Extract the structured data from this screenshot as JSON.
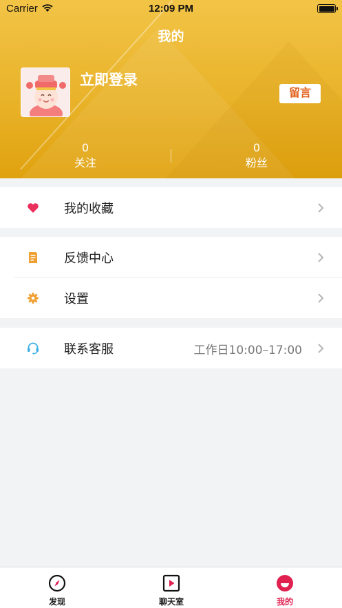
{
  "status_bar": {
    "carrier": "Carrier",
    "time": "12:09 PM"
  },
  "header": {
    "title": "我的",
    "login_text": "立即登录",
    "message_button": "留言",
    "stats": [
      {
        "value": "0",
        "label": "关注"
      },
      {
        "value": "0",
        "label": "粉丝"
      }
    ]
  },
  "menu": {
    "favorites": {
      "label": "我的收藏",
      "icon": "heart-icon"
    },
    "feedback": {
      "label": "反馈中心",
      "icon": "document-icon"
    },
    "settings": {
      "label": "设置",
      "icon": "gear-icon"
    },
    "support": {
      "label": "联系客服",
      "value": "工作日10:00–17:00",
      "icon": "headset-icon"
    }
  },
  "tabbar": {
    "tabs": [
      {
        "label": "发现",
        "icon": "compass-icon"
      },
      {
        "label": "聊天室",
        "icon": "play-icon"
      },
      {
        "label": "我的",
        "icon": "profile-icon",
        "active": true
      }
    ]
  },
  "colors": {
    "header_gradient_top": "#f2c446",
    "header_gradient_bottom": "#e0a20e",
    "accent_red": "#e0204f",
    "message_text": "#e2631e"
  }
}
